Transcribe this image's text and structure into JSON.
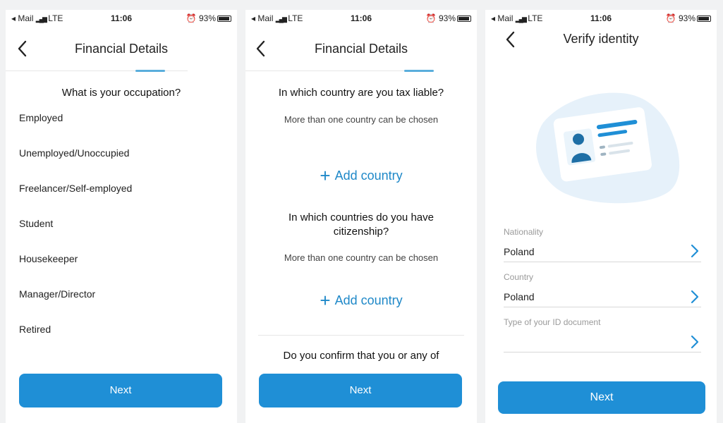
{
  "status": {
    "left": "◂ Mail",
    "network": "LTE",
    "time": "11:06",
    "battery": "93%"
  },
  "screen1": {
    "title": "Financial Details",
    "question": "What is your occupation?",
    "options": [
      "Employed",
      "Unemployed/Unoccupied",
      "Freelancer/Self-employed",
      "Student",
      "Housekeeper",
      "Manager/Director",
      "Retired"
    ],
    "next_label": "Next"
  },
  "screen2": {
    "title": "Financial Details",
    "q1": "In which country are you tax liable?",
    "hint1": "More than one country can be chosen",
    "add1": "Add country",
    "q2": "In which countries do you have citizenship?",
    "hint2": "More than one country can be chosen",
    "add2": "Add country",
    "q3": "Do you confirm that you or any of",
    "next_label": "Next"
  },
  "screen3": {
    "title": "Verify identity",
    "nationality_label": "Nationality",
    "nationality_value": "Poland",
    "country_label": "Country",
    "country_value": "Poland",
    "doc_label": "Type of your ID document",
    "doc_value": "",
    "next_label": "Next"
  },
  "colors": {
    "accent": "#1f8fd6",
    "accent_light": "#5aaedc",
    "card_bg": "#eaf4fb"
  },
  "icons": [
    "back-arrow-icon",
    "plus-icon",
    "chevron-right-icon",
    "id-card-icon",
    "battery-icon",
    "signal-icon",
    "alarm-icon"
  ]
}
